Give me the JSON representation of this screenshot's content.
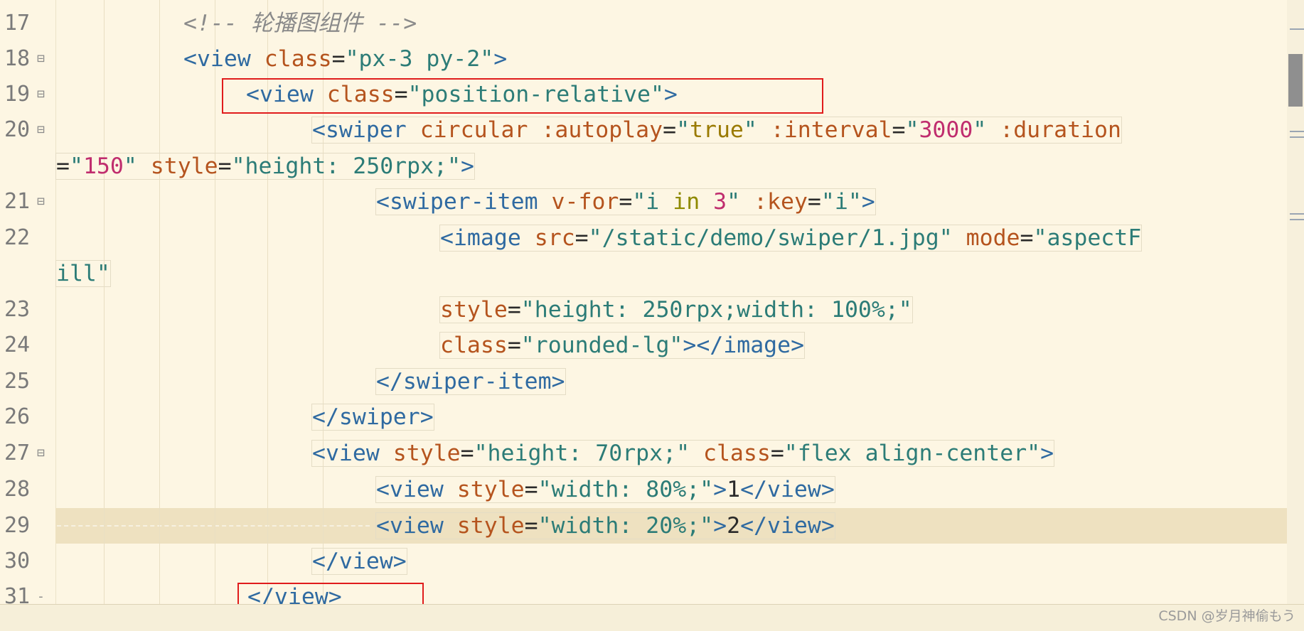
{
  "editor": {
    "lines": [
      {
        "num": "17",
        "fold": "",
        "tokens": [
          {
            "t": "<!-- ",
            "c": "comment"
          },
          {
            "t": "轮播图组件",
            "c": "comment"
          },
          {
            "t": " -->",
            "c": "comment"
          }
        ]
      },
      {
        "num": "18",
        "fold": "⊟",
        "tokens": [
          {
            "t": "<view ",
            "c": "tag"
          },
          {
            "t": "class",
            "c": "attr"
          },
          {
            "t": "=",
            "c": "plain"
          },
          {
            "t": "\"px-3 py-2\"",
            "c": "str"
          },
          {
            "t": ">",
            "c": "tag"
          }
        ]
      },
      {
        "num": "19",
        "fold": "⊟",
        "tokens": [
          {
            "t": "<view ",
            "c": "tag"
          },
          {
            "t": "class",
            "c": "attr"
          },
          {
            "t": "=",
            "c": "plain"
          },
          {
            "t": "\"position-relative\"",
            "c": "str"
          },
          {
            "t": ">",
            "c": "tag"
          }
        ]
      },
      {
        "num": "20",
        "fold": "⊟",
        "tokens": [
          {
            "t": "<swiper ",
            "c": "tag"
          },
          {
            "t": "circular ",
            "c": "attr"
          },
          {
            "t": ":autoplay",
            "c": "attr"
          },
          {
            "t": "=",
            "c": "plain"
          },
          {
            "t": "\"",
            "c": "str"
          },
          {
            "t": "true",
            "c": "bool"
          },
          {
            "t": "\" ",
            "c": "str"
          },
          {
            "t": ":interval",
            "c": "attr"
          },
          {
            "t": "=",
            "c": "plain"
          },
          {
            "t": "\"",
            "c": "str"
          },
          {
            "t": "3000",
            "c": "num"
          },
          {
            "t": "\" ",
            "c": "str"
          },
          {
            "t": ":duration",
            "c": "attr"
          }
        ]
      },
      {
        "num": "",
        "fold": "",
        "tokens": [
          {
            "t": "=",
            "c": "plain"
          },
          {
            "t": "\"",
            "c": "str"
          },
          {
            "t": "150",
            "c": "num"
          },
          {
            "t": "\" ",
            "c": "str"
          },
          {
            "t": "style",
            "c": "attr"
          },
          {
            "t": "=",
            "c": "plain"
          },
          {
            "t": "\"height: 250rpx;\"",
            "c": "str"
          },
          {
            "t": ">",
            "c": "tag"
          }
        ]
      },
      {
        "num": "21",
        "fold": "⊟",
        "tokens": [
          {
            "t": "<swiper-item ",
            "c": "tag"
          },
          {
            "t": "v-for",
            "c": "attr"
          },
          {
            "t": "=",
            "c": "plain"
          },
          {
            "t": "\"i ",
            "c": "str"
          },
          {
            "t": "in",
            "c": "kw"
          },
          {
            "t": " ",
            "c": "str"
          },
          {
            "t": "3",
            "c": "num"
          },
          {
            "t": "\" ",
            "c": "str"
          },
          {
            "t": ":key",
            "c": "attr"
          },
          {
            "t": "=",
            "c": "plain"
          },
          {
            "t": "\"i\"",
            "c": "str"
          },
          {
            "t": ">",
            "c": "tag"
          }
        ]
      },
      {
        "num": "22",
        "fold": "",
        "tokens": [
          {
            "t": "<image ",
            "c": "tag"
          },
          {
            "t": "src",
            "c": "attr"
          },
          {
            "t": "=",
            "c": "plain"
          },
          {
            "t": "\"/static/demo/swiper/1.jpg\" ",
            "c": "str"
          },
          {
            "t": "mode",
            "c": "attr"
          },
          {
            "t": "=",
            "c": "plain"
          },
          {
            "t": "\"aspectF",
            "c": "str"
          }
        ]
      },
      {
        "num": "",
        "fold": "",
        "tokens": [
          {
            "t": "ill\"",
            "c": "str"
          }
        ]
      },
      {
        "num": "23",
        "fold": "",
        "tokens": [
          {
            "t": "style",
            "c": "attr"
          },
          {
            "t": "=",
            "c": "plain"
          },
          {
            "t": "\"height: 250rpx;width: 100%;\"",
            "c": "str"
          }
        ]
      },
      {
        "num": "24",
        "fold": "",
        "tokens": [
          {
            "t": "class",
            "c": "attr"
          },
          {
            "t": "=",
            "c": "plain"
          },
          {
            "t": "\"rounded-lg\"",
            "c": "str"
          },
          {
            "t": "></image>",
            "c": "tag"
          }
        ]
      },
      {
        "num": "25",
        "fold": "",
        "tokens": [
          {
            "t": "</swiper-item>",
            "c": "tag"
          }
        ]
      },
      {
        "num": "26",
        "fold": "",
        "tokens": [
          {
            "t": "</swiper>",
            "c": "tag"
          }
        ]
      },
      {
        "num": "27",
        "fold": "⊟",
        "tokens": [
          {
            "t": "<view ",
            "c": "tag"
          },
          {
            "t": "style",
            "c": "attr"
          },
          {
            "t": "=",
            "c": "plain"
          },
          {
            "t": "\"height: 70rpx;\" ",
            "c": "str"
          },
          {
            "t": "class",
            "c": "attr"
          },
          {
            "t": "=",
            "c": "plain"
          },
          {
            "t": "\"flex align-center\"",
            "c": "str"
          },
          {
            "t": ">",
            "c": "tag"
          }
        ]
      },
      {
        "num": "28",
        "fold": "",
        "tokens": [
          {
            "t": "<view ",
            "c": "tag"
          },
          {
            "t": "style",
            "c": "attr"
          },
          {
            "t": "=",
            "c": "plain"
          },
          {
            "t": "\"width: 80%;\"",
            "c": "str"
          },
          {
            "t": ">",
            "c": "tag"
          },
          {
            "t": "1",
            "c": "plain"
          },
          {
            "t": "</view>",
            "c": "tag"
          }
        ]
      },
      {
        "num": "29",
        "fold": "",
        "tokens": [
          {
            "t": "<view ",
            "c": "tag"
          },
          {
            "t": "style",
            "c": "attr"
          },
          {
            "t": "=",
            "c": "plain"
          },
          {
            "t": "\"width: 20%;\"",
            "c": "str"
          },
          {
            "t": ">",
            "c": "tag"
          },
          {
            "t": "2",
            "c": "plain"
          },
          {
            "t": "</view>",
            "c": "tag"
          }
        ]
      },
      {
        "num": "30",
        "fold": "",
        "tokens": [
          {
            "t": "</view>",
            "c": "tag"
          }
        ]
      },
      {
        "num": "31",
        "fold": "-",
        "tokens": [
          {
            "t": "</view>",
            "c": "tag"
          }
        ]
      }
    ]
  },
  "watermark": "CSDN @岁月神偷もう",
  "colors": {
    "background": "#fdf6e3",
    "tag": "#2f6aa1",
    "attr": "#b5541e",
    "string": "#2c7c77",
    "number": "#c02d6e",
    "highlight_box": "#e01c1c"
  }
}
